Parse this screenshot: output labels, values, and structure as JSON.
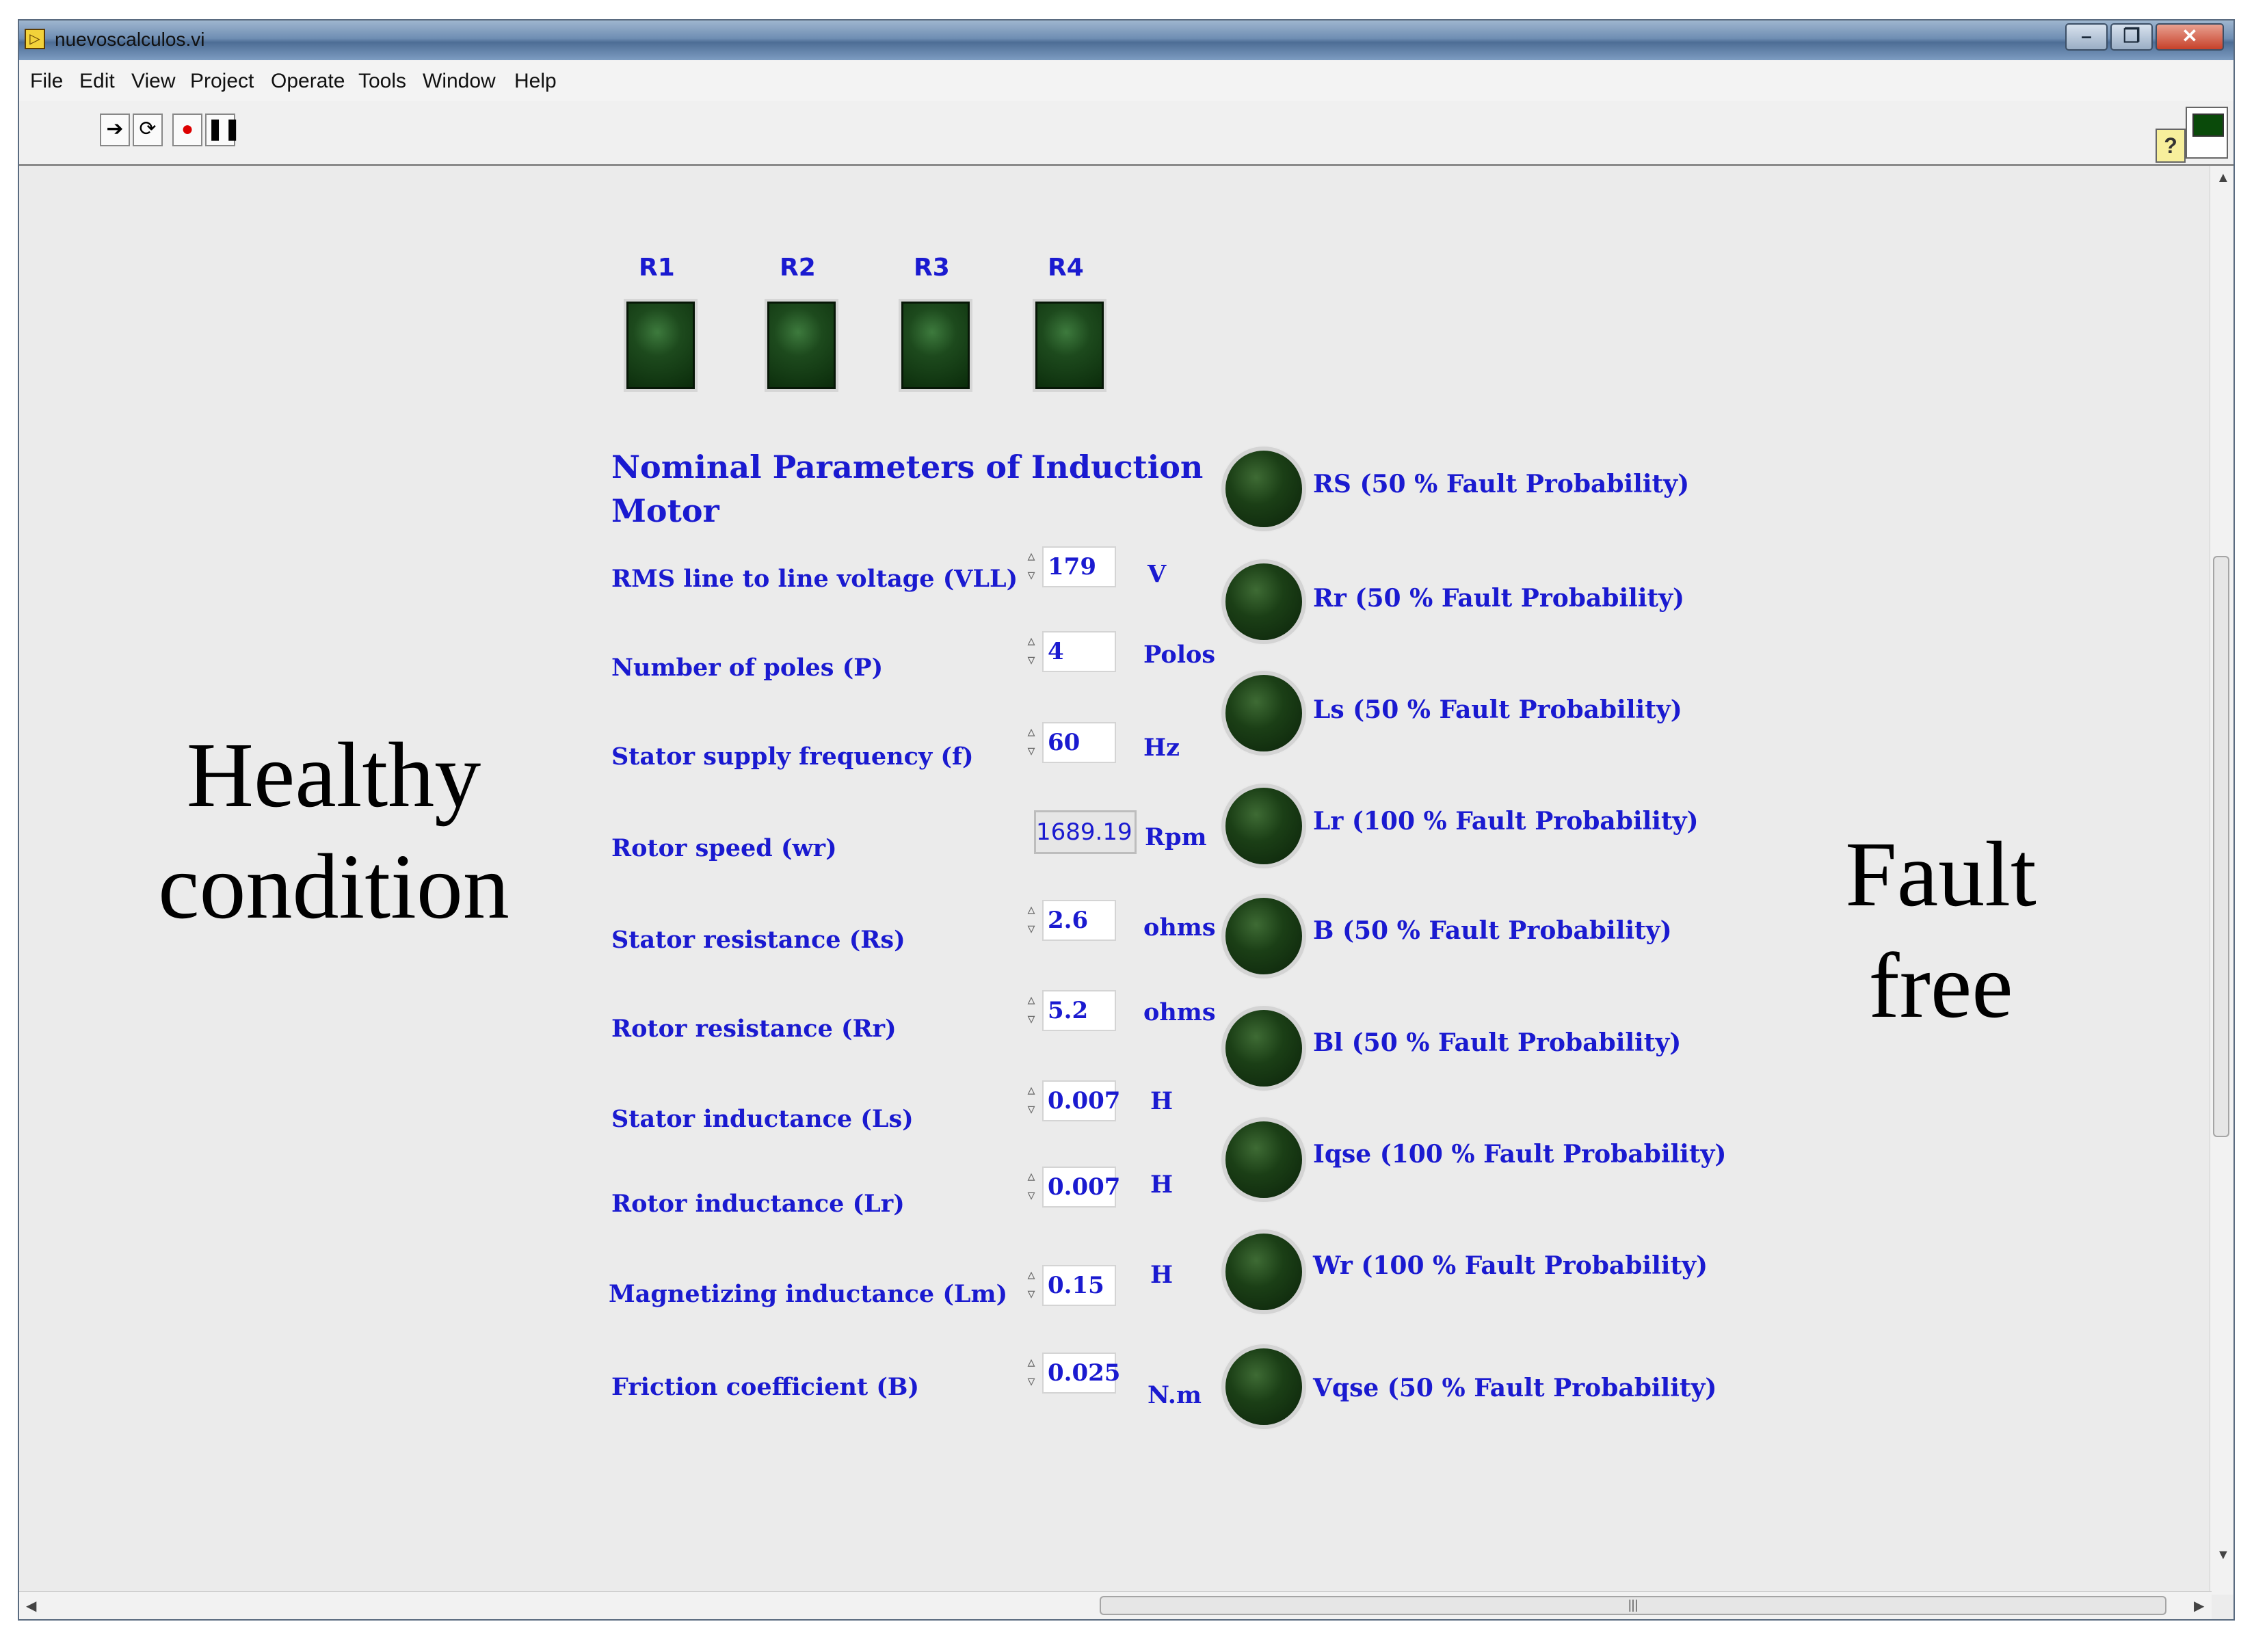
{
  "window": {
    "title": "nuevoscalculos.vi"
  },
  "menu": [
    "File",
    "Edit",
    "View",
    "Project",
    "Operate",
    "Tools",
    "Window",
    "Help"
  ],
  "left_text": {
    "line1": "Healthy",
    "line2": "condition"
  },
  "right_text": {
    "line1": "Fault",
    "line2": "free"
  },
  "square_leds": [
    "R1",
    "R2",
    "R3",
    "R4"
  ],
  "section_title": {
    "line1": "Nominal Parameters of Induction",
    "line2": "Motor"
  },
  "parameters": [
    {
      "label": "RMS line to line voltage (VLL)",
      "value": "179",
      "unit": "V"
    },
    {
      "label": "Number of poles (P)",
      "value": "4",
      "unit": "Polos"
    },
    {
      "label": "Stator supply frequency  (f)",
      "value": "60",
      "unit": "Hz"
    },
    {
      "label": "Rotor speed  (wr)",
      "value": "1689.19",
      "unit": "Rpm"
    },
    {
      "label": "Stator resistance (Rs)",
      "value": "2.6",
      "unit": "ohms"
    },
    {
      "label": "Rotor resistance (Rr)",
      "value": "5.2",
      "unit": "ohms"
    },
    {
      "label": "Stator inductance (Ls)",
      "value": "0.007",
      "unit": "H"
    },
    {
      "label": "Rotor inductance (Lr)",
      "value": "0.007",
      "unit": "H"
    },
    {
      "label": "Magnetizing inductance (Lm)",
      "value": "0.15",
      "unit": "H"
    },
    {
      "label": "Friction coefficient (B)",
      "value": "0.025",
      "unit": "N.m"
    }
  ],
  "fault_indicators": [
    "RS   (50 % Fault Probability)",
    "Rr (50 % Fault Probability)",
    "Ls (50 % Fault Probability)",
    "Lr (100 % Fault Probability)",
    "B (50 % Fault Probability)",
    "Bl (50 % Fault Probability)",
    "Iqse (100 % Fault Probability)",
    "Wr (100 % Fault Probability)",
    "Vqse (50 % Fault Probability)"
  ],
  "colors": {
    "label_blue": "#1a1ad0",
    "led_dark_green": "#0b220a",
    "panel_bg": "#ebebeb"
  },
  "icons": {
    "run": "run-arrow-icon",
    "run_continuous": "run-continuous-icon",
    "abort": "abort-icon",
    "pause": "pause-icon",
    "help": "help-icon"
  }
}
